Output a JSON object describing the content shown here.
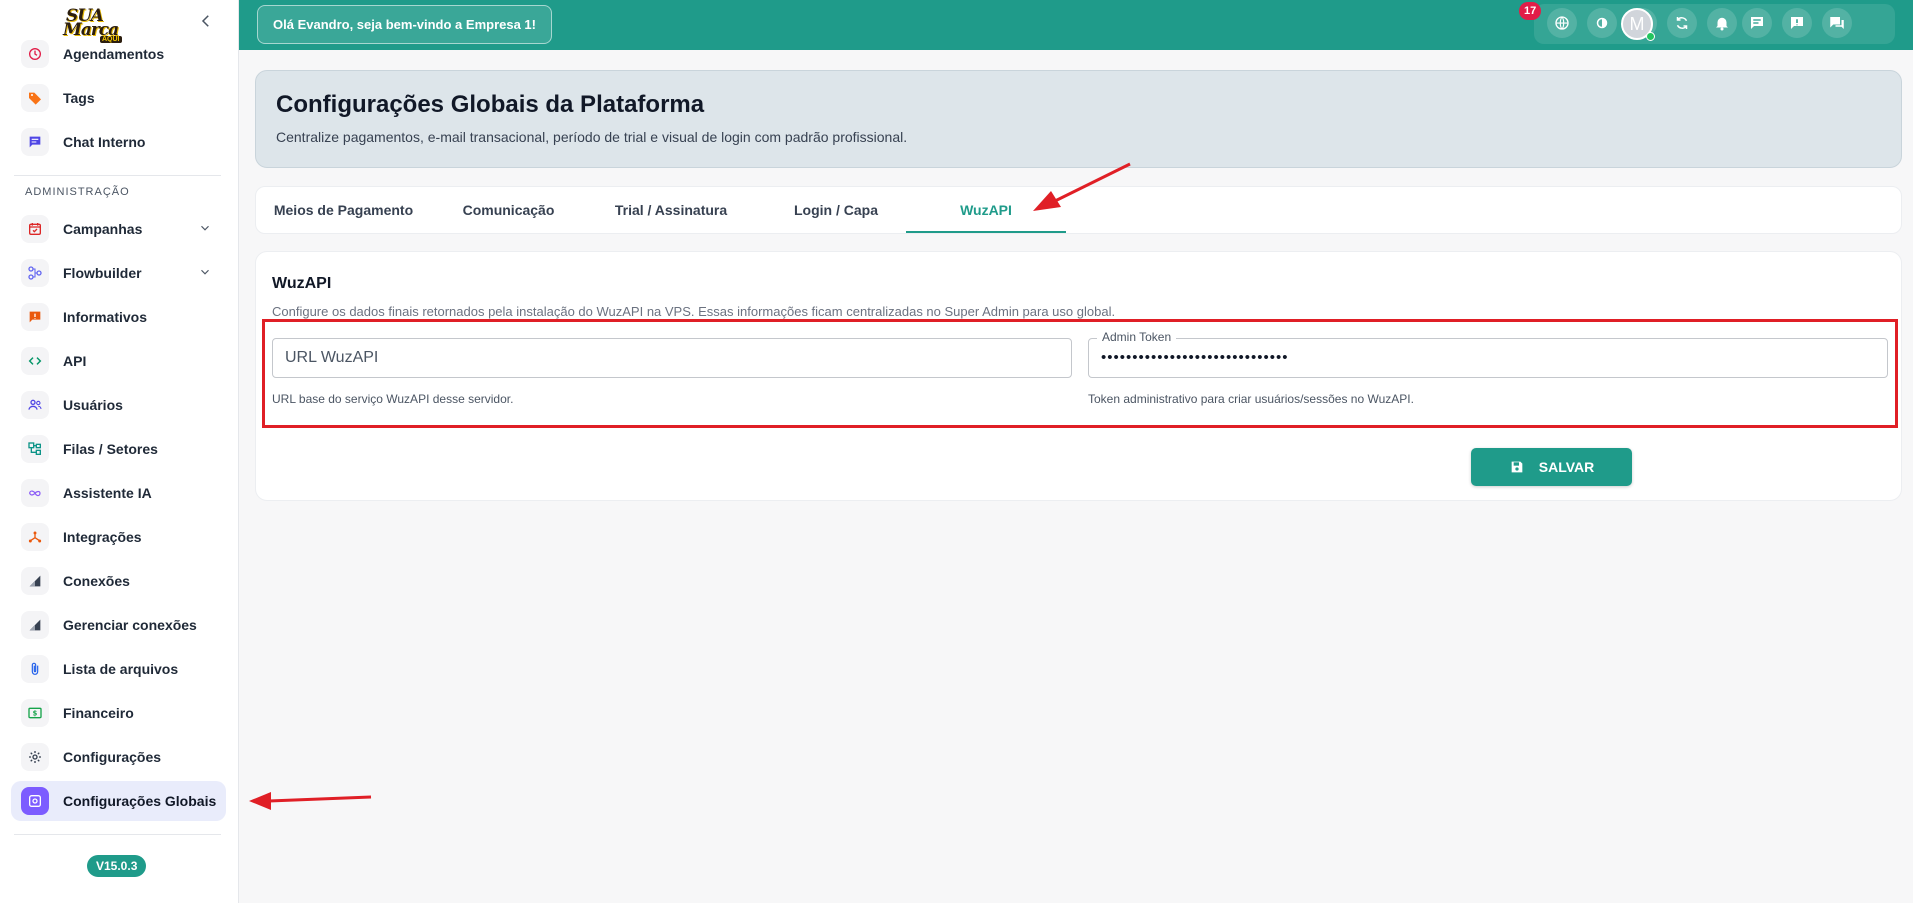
{
  "sidebar": {
    "logo": {
      "line1": "SUA",
      "line2": "Marca",
      "line3": "AQUI"
    },
    "section_admin": "ADMINISTRAÇÃO",
    "items": [
      {
        "label": "Agendamentos",
        "icon": "clock-icon",
        "color": "#e11d48"
      },
      {
        "label": "Tags",
        "icon": "tag-icon",
        "color": "#f97316"
      },
      {
        "label": "Chat Interno",
        "icon": "chat-icon",
        "color": "#4f46e5"
      },
      {
        "label": "Campanhas",
        "icon": "calendar-check-icon",
        "color": "#dc2626"
      },
      {
        "label": "Flowbuilder",
        "icon": "flow-icon",
        "color": "#6366f1"
      },
      {
        "label": "Informativos",
        "icon": "alert-message-icon",
        "color": "#ea580c"
      },
      {
        "label": "API",
        "icon": "code-icon",
        "color": "#059669"
      },
      {
        "label": "Usuários",
        "icon": "users-icon",
        "color": "#4f46e5"
      },
      {
        "label": "Filas / Setores",
        "icon": "queue-icon",
        "color": "#0d9488"
      },
      {
        "label": "Assistente IA",
        "icon": "infinity-icon",
        "color": "#8b5cf6"
      },
      {
        "label": "Integrações",
        "icon": "integration-icon",
        "color": "#ea580c"
      },
      {
        "label": "Conexões",
        "icon": "signal-icon",
        "color": "#374151"
      },
      {
        "label": "Gerenciar conexões",
        "icon": "signal-icon",
        "color": "#374151"
      },
      {
        "label": "Lista de arquivos",
        "icon": "paperclip-icon",
        "color": "#2563eb"
      },
      {
        "label": "Financeiro",
        "icon": "money-icon",
        "color": "#16a34a"
      },
      {
        "label": "Configurações",
        "icon": "gear-icon",
        "color": "#374151"
      },
      {
        "label": "Configurações Globais",
        "icon": "global-settings-icon",
        "color": "#ffffff"
      }
    ],
    "version": "V15.0.3"
  },
  "topbar": {
    "greeting": "Olá Evandro, seja bem-vindo a Empresa 1!",
    "badge_count": "17",
    "avatar_initial": "M"
  },
  "hero": {
    "title": "Configurações Globais da Plataforma",
    "subtitle": "Centralize pagamentos, e-mail transacional, período de trial e visual de login com padrão profissional."
  },
  "tabs": [
    "Meios de Pagamento",
    "Comunicação",
    "Trial / Assinatura",
    "Login / Capa",
    "WuzAPI"
  ],
  "active_tab": "WuzAPI",
  "card": {
    "title": "WuzAPI",
    "description": "Configure os dados finais retornados pela instalação do WuzAPI na VPS. Essas informações ficam centralizadas no Super Admin para uso global.",
    "url_field": {
      "placeholder": "URL WuzAPI",
      "value": "",
      "helper": "URL base do serviço WuzAPI desse servidor."
    },
    "token_field": {
      "label": "Admin Token",
      "value": "••••••••••••••••••••••••••••••",
      "helper": "Token administrativo para criar usuários/sessões no WuzAPI."
    },
    "save_label": "SALVAR"
  },
  "colors": {
    "primary": "#1f9b8a",
    "annotation": "#e01f26",
    "active_nav": "#7c5cff"
  }
}
